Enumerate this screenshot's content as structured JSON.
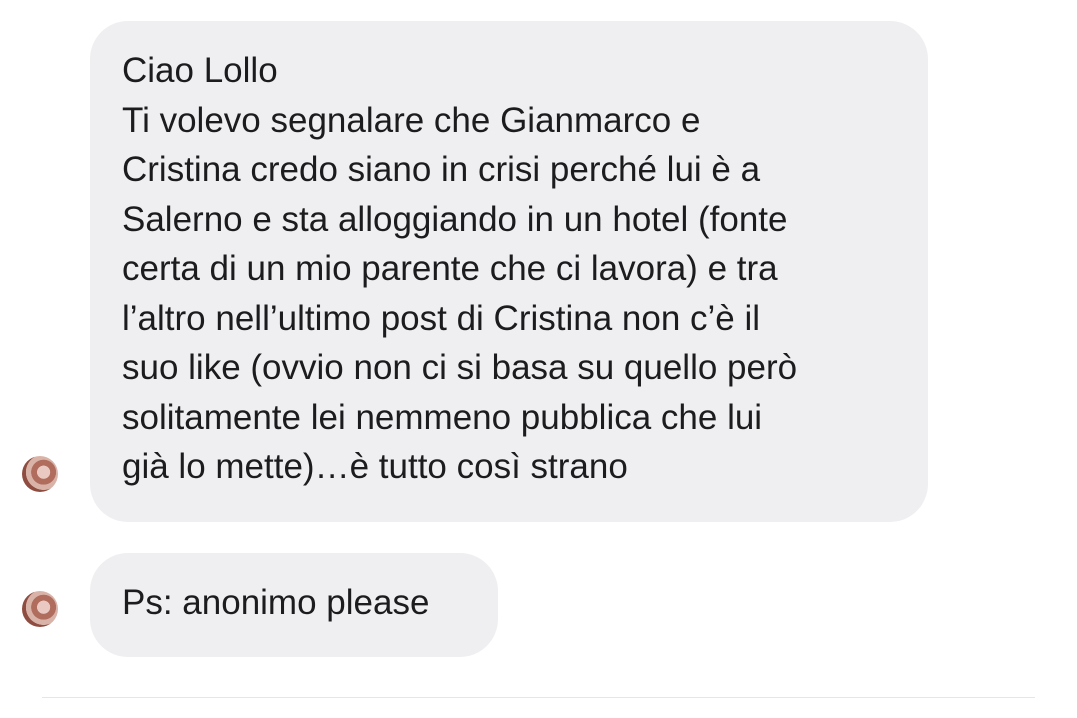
{
  "messages": [
    {
      "lines": [
        "Ciao Lollo",
        "Ti volevo segnalare che Gianmarco e",
        "Cristina credo siano in crisi perché lui è a",
        "Salerno e sta alloggiando in un hotel (fonte",
        "certa di un mio parente che ci lavora) e tra",
        "l’altro nell’ultimo post di Cristina non c’è il",
        "suo like (ovvio non ci si basa su quello però",
        "solitamente lei nemmeno pubblica che lui",
        "già lo mette)…è tutto così strano"
      ]
    },
    {
      "lines": [
        "Ps: anonimo please"
      ]
    }
  ],
  "colors": {
    "bubble_background": "#efeff1",
    "text": "#1c1c1e",
    "page_background": "#ffffff"
  },
  "icons": {
    "sender_avatar": "avatar"
  }
}
